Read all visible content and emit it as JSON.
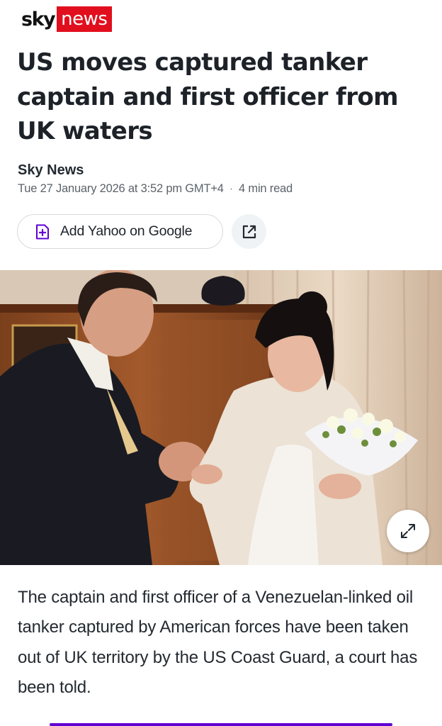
{
  "brand": {
    "sky": "sky",
    "news": "news",
    "news_color": "#e10f1e"
  },
  "article": {
    "headline": "US moves captured tanker captain and first officer from UK waters",
    "source": "Sky News",
    "date": "Tue 27 January 2026 at 3:52 pm GMT+4",
    "read_time": "4 min read",
    "body": "The captain and first officer of a Venezuelan-linked oil tanker captured by American forces have been taken out of UK territory by the US Coast Guard, a court has been told."
  },
  "actions": {
    "add_source_label": "Add Yahoo on Google",
    "add_source_icon": "add-plus-icon",
    "share_icon": "external-share-icon",
    "accent_color": "#6001d2"
  },
  "photo": {
    "expand_icon": "expand-arrows-icon"
  }
}
